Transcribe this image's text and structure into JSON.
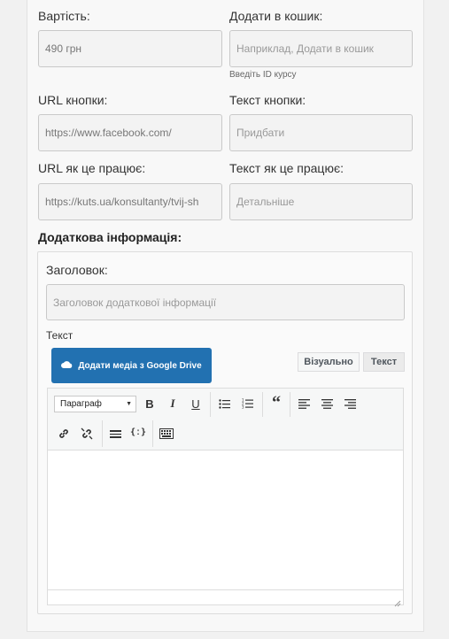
{
  "price": {
    "label": "Вартість:",
    "value": "490 грн"
  },
  "add_to_cart": {
    "label": "Додати в кошик:",
    "placeholder": "Наприклад, Додати в кошик",
    "hint": "Введіть ID курсу"
  },
  "button_url": {
    "label": "URL кнопки:",
    "value": "https://www.facebook.com/"
  },
  "button_text": {
    "label": "Текст кнопки:",
    "placeholder": "Придбати"
  },
  "how_url": {
    "label": "URL як це працює:",
    "value": "https://kuts.ua/konsultanty/tvij-sh"
  },
  "how_text": {
    "label": "Текст як це працює:",
    "placeholder": "Детальніше"
  },
  "extra": {
    "title": "Додаткова інформація:",
    "heading_label": "Заголовок:",
    "heading_placeholder": "Заголовок додаткової інформації",
    "text_label": "Текст"
  },
  "editor": {
    "google_drive_button": "Додати медіа з Google Drive",
    "tab_visual": "Візуально",
    "tab_text": "Текст",
    "format_select": "Параграф",
    "icons": [
      "bold-icon",
      "italic-icon",
      "underline-icon",
      "bullet-list-icon",
      "numbered-list-icon",
      "blockquote-icon",
      "align-left-icon",
      "align-center-icon",
      "align-right-icon",
      "link-icon",
      "unlink-icon",
      "more-tag-icon",
      "shortcode-icon",
      "toolbar-toggle-icon"
    ]
  },
  "colors": {
    "primary_button": "#2271b1"
  }
}
